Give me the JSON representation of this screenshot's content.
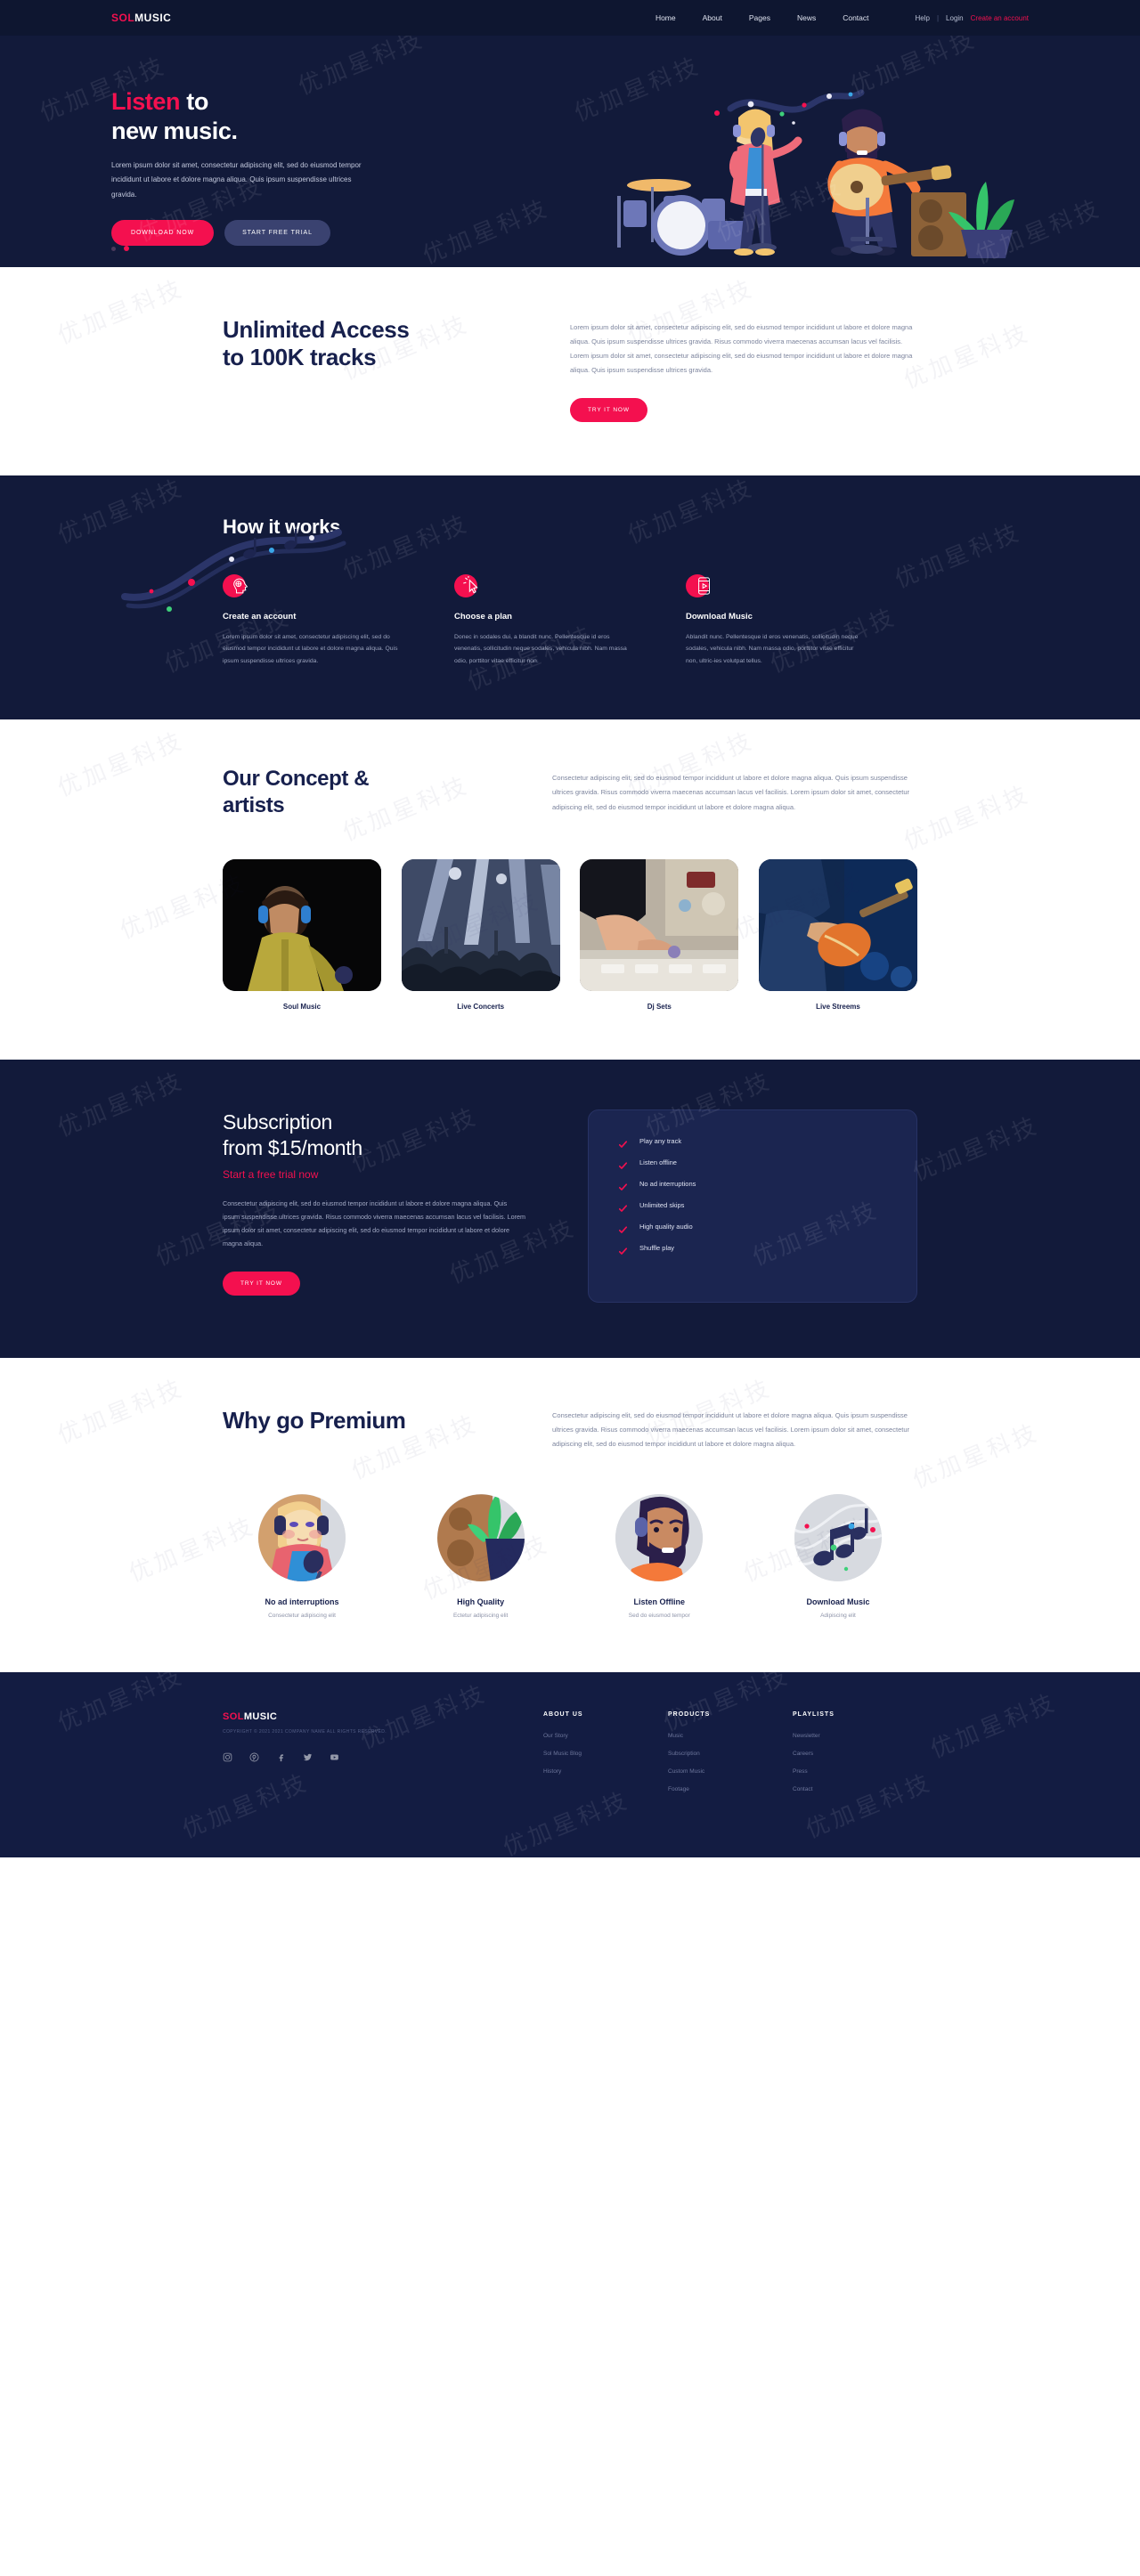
{
  "brand": {
    "part1": "SOL",
    "part2": "MUSIC"
  },
  "header": {
    "nav": [
      {
        "label": "Home"
      },
      {
        "label": "About"
      },
      {
        "label": "Pages"
      },
      {
        "label": "News"
      },
      {
        "label": "Contact"
      }
    ],
    "help": "Help",
    "separator": "|",
    "login": "Login",
    "create_account": "Create an account"
  },
  "hero": {
    "title_highlight": "Listen",
    "title_rest": " to",
    "title_line2": "new music.",
    "paragraph": "Lorem ipsum dolor sit amet, consectetur adipiscing elit, sed do eiusmod tempor incididunt ut labore et dolore magna aliqua. Quis ipsum suspendisse ultrices gravida.",
    "btn_download": "DOWNLOAD NOW",
    "btn_trial": "START FREE TRIAL",
    "dots": [
      {
        "active": false
      },
      {
        "active": true
      }
    ]
  },
  "unlimited": {
    "title_line1": "Unlimited Access",
    "title_line2": "to 100K tracks",
    "paragraph": "Lorem ipsum dolor sit amet, consectetur adipiscing elit, sed do eiusmod tempor incididunt ut labore et dolore magna aliqua. Quis ipsum suspendisse ultrices gravida. Risus commodo viverra maecenas accumsan lacus vel facilisis. Lorem ipsum dolor sit amet, consectetur adipiscing elit, sed do eiusmod tempor incididunt ut labore et dolore magna aliqua. Quis ipsum suspendisse ultrices gravida.",
    "cta": "TRY IT NOW"
  },
  "how_it_works": {
    "title": "How it works",
    "steps": [
      {
        "icon": "head-idea-icon",
        "title": "Create an account",
        "text": "Lorem ipsum dolor sit amet, consectetur adipiscing elit, sed do eiusmod tempor incididunt ut labore et dolore magna aliqua. Quis ipsum suspendisse ultrices gravida."
      },
      {
        "icon": "cursor-click-icon",
        "title": "Choose a plan",
        "text": "Donec in sodales dui, a blandit nunc. Pellentesque id eros venenatis, sollicitudin neque sodales, vehicula nibh. Nam massa odio, porttitor vitae efficitur non."
      },
      {
        "icon": "mobile-play-icon",
        "title": "Download Music",
        "text": "Ablandit nunc. Pellentesque id eros venenatis, sollicitudin neque sodales, vehicula nibh. Nam massa odio, porttitor vitae efficitur non, ultric-ies volutpat tellus."
      }
    ]
  },
  "concept": {
    "title_line1": "Our Concept &",
    "title_line2": "artists",
    "paragraph": "Consectetur adipiscing elit, sed do eiusmod tempor incididunt ut labore et dolore magna aliqua. Quis ipsum suspendisse ultrices gravida. Risus commodo viverra maecenas accumsan lacus vel facilisis. Lorem ipsum dolor sit amet, consectetur adipiscing elit, sed do eiusmod tempor incididunt ut labore et dolore magna aliqua.",
    "cards": [
      {
        "caption": "Soul Music",
        "image": "singer-with-headphones-photo"
      },
      {
        "caption": "Live Concerts",
        "image": "concert-crowd-photo"
      },
      {
        "caption": "Dj Sets",
        "image": "dj-mixer-hands-photo"
      },
      {
        "caption": "Live Streems",
        "image": "guitarist-on-stage-photo"
      }
    ]
  },
  "subscription": {
    "title_line1": "Subscription",
    "title_line2": "from $15/month",
    "subtitle": "Start a free trial now",
    "paragraph": "Consectetur adipiscing elit, sed do eiusmod tempor incididunt ut labore et dolore magna aliqua. Quis ipsum suspendisse ultrices gravida. Risus commodo viverra maecenas accumsan lacus vel facilisis. Lorem ipsum dolor sit amet, consectetur adipiscing elit, sed do eiusmod tempor incididunt ut labore et dolore magna aliqua.",
    "cta": "TRY IT NOW",
    "features": [
      {
        "label": "Play any track"
      },
      {
        "label": "Listen offline"
      },
      {
        "label": "No ad interruptions"
      },
      {
        "label": "Unlimited skips"
      },
      {
        "label": "High quality audio"
      },
      {
        "label": "Shuffle play"
      }
    ]
  },
  "premium": {
    "title": "Why go Premium",
    "paragraph": "Consectetur adipiscing elit, sed do eiusmod tempor incididunt ut labore et dolore magna aliqua. Quis ipsum suspendisse ultrices gravida. Risus commodo viverra maecenas accumsan lacus vel facilisis. Lorem ipsum dolor sit amet, consectetur adipiscing elit, sed do eiusmod tempor incididunt ut labore et dolore magna aliqua.",
    "cards": [
      {
        "title": "No ad interruptions",
        "subtitle": "Consectetur adipiscing elit",
        "avatar": "singer-avatar"
      },
      {
        "title": "High Quality",
        "subtitle": "Ectetur adipiscing elit",
        "avatar": "speaker-plant-avatar"
      },
      {
        "title": "Listen Offline",
        "subtitle": "Sed do eiusmod tempor",
        "avatar": "guitarist-avatar"
      },
      {
        "title": "Download Music",
        "subtitle": "Adipiscing elit",
        "avatar": "music-notes-avatar"
      }
    ]
  },
  "footer": {
    "copyright": "COPYRIGHT © 2021 2021 COMPANY NAME ALL RIGHTS RESERVED.",
    "socials": [
      {
        "name": "instagram-icon"
      },
      {
        "name": "pinterest-icon"
      },
      {
        "name": "facebook-icon"
      },
      {
        "name": "twitter-icon"
      },
      {
        "name": "youtube-icon"
      }
    ],
    "columns": [
      {
        "heading": "ABOUT US",
        "links": [
          {
            "label": "Our Story"
          },
          {
            "label": "Sol Music Blog"
          },
          {
            "label": "History"
          }
        ]
      },
      {
        "heading": "PRODUCTS",
        "links": [
          {
            "label": "Music"
          },
          {
            "label": "Subscription"
          },
          {
            "label": "Custom Music"
          },
          {
            "label": "Footage"
          }
        ]
      },
      {
        "heading": "PLAYLISTS",
        "links": [
          {
            "label": "Newsletter"
          },
          {
            "label": "Careers"
          },
          {
            "label": "Press"
          },
          {
            "label": "Contact"
          }
        ]
      }
    ]
  },
  "colors": {
    "accent": "#f4104f",
    "dark_navy": "#121a3a",
    "header_navy": "#0e1630",
    "panel_navy": "#1b2550",
    "heading_navy": "#17204d",
    "body_gray": "#7c849d"
  },
  "watermark": {
    "text": "优加星科技"
  }
}
